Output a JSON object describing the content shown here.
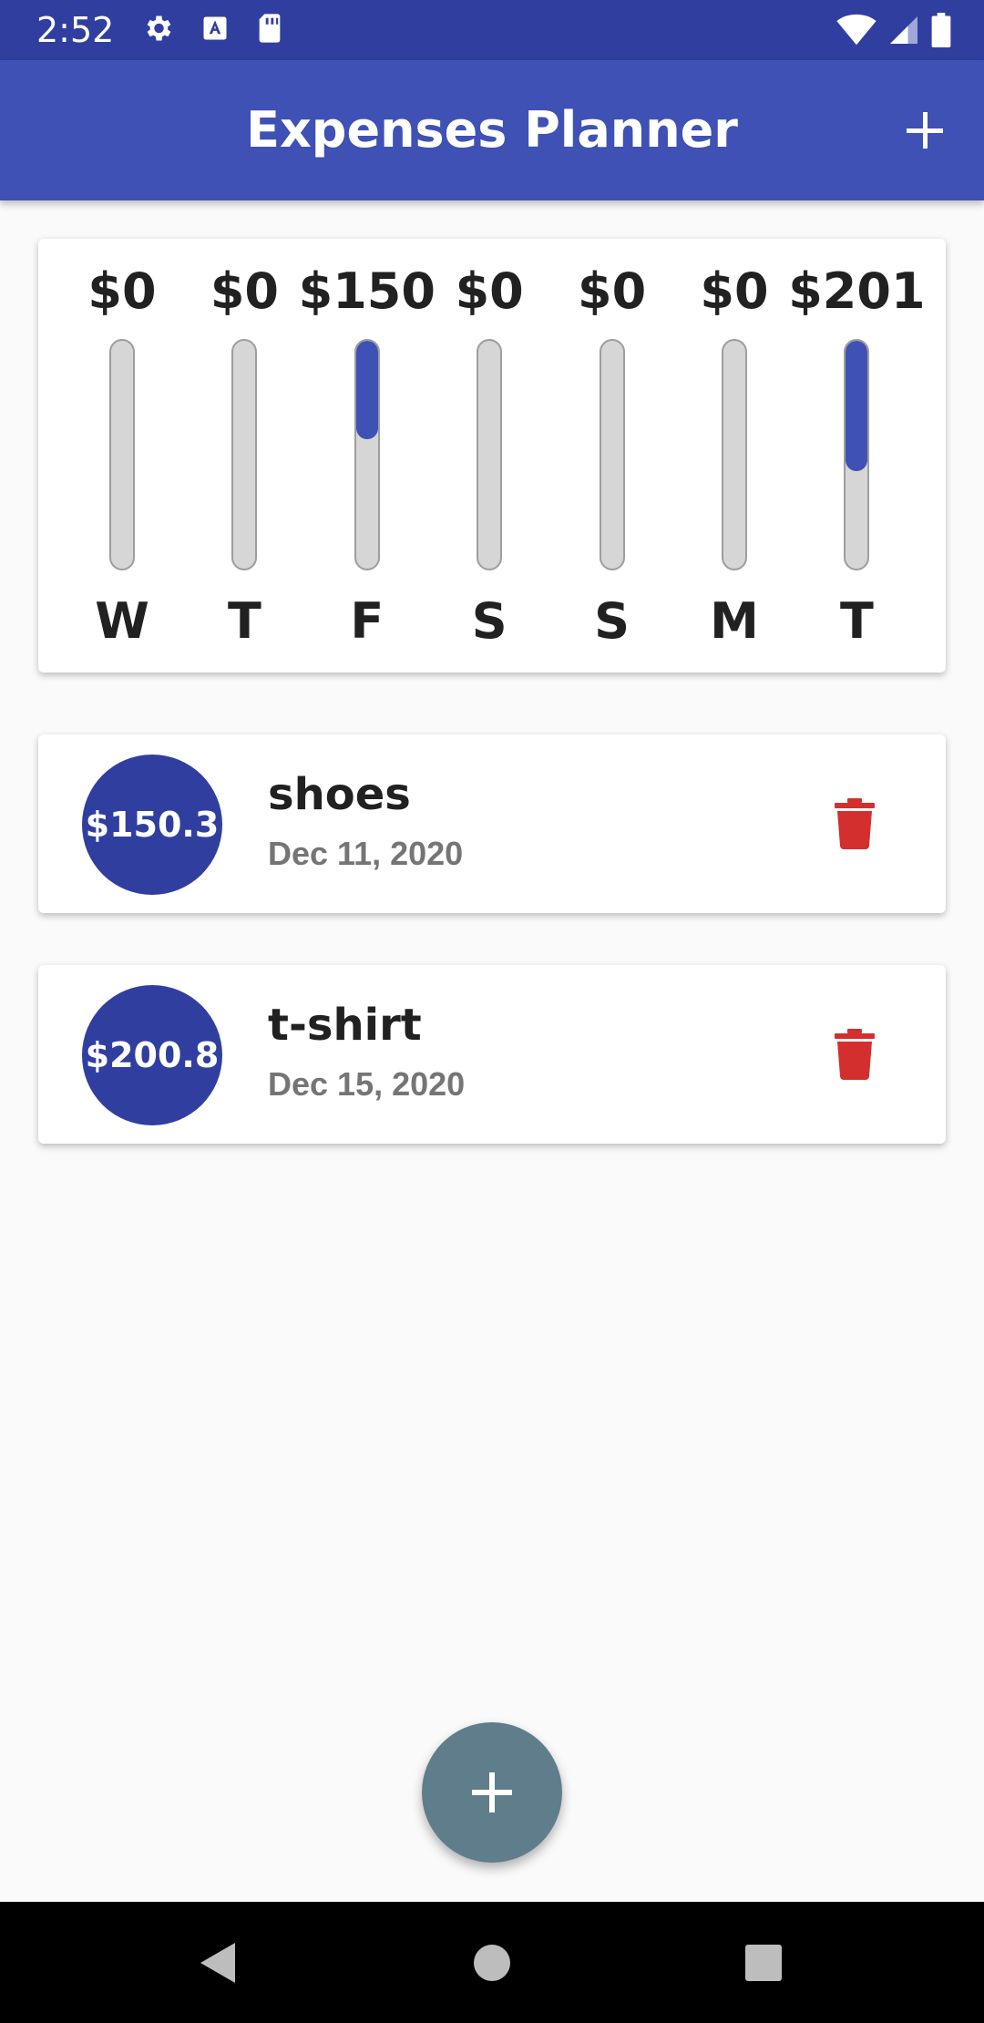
{
  "status_bar": {
    "time": "2:52",
    "icons_left": [
      "gear-icon",
      "text-a-icon",
      "sd-card-icon"
    ],
    "icons_right": [
      "wifi-icon",
      "signal-icon",
      "battery-icon"
    ]
  },
  "app_bar": {
    "title": "Expenses Planner",
    "add_icon": "plus-icon"
  },
  "chart": {
    "bars": [
      {
        "day": "W",
        "amount_label": "$0",
        "fraction": 0
      },
      {
        "day": "T",
        "amount_label": "$0",
        "fraction": 0
      },
      {
        "day": "F",
        "amount_label": "$150",
        "fraction": 0.43
      },
      {
        "day": "S",
        "amount_label": "$0",
        "fraction": 0
      },
      {
        "day": "S",
        "amount_label": "$0",
        "fraction": 0
      },
      {
        "day": "M",
        "amount_label": "$0",
        "fraction": 0
      },
      {
        "day": "T",
        "amount_label": "$201",
        "fraction": 0.57
      }
    ],
    "fill_color": "#3f51b5"
  },
  "transactions": [
    {
      "amount": "$150.3",
      "title": "shoes",
      "date": "Dec 11, 2020"
    },
    {
      "amount": "$200.8",
      "title": "t-shirt",
      "date": "Dec 15, 2020"
    }
  ],
  "colors": {
    "primary": "#3f51b5",
    "primary_dark": "#303f9f",
    "fab": "#607d8b",
    "delete": "#d32f2f"
  },
  "fab": {
    "icon": "plus-icon"
  },
  "nav": {
    "icons": [
      "back-icon",
      "home-icon",
      "recents-icon"
    ]
  }
}
